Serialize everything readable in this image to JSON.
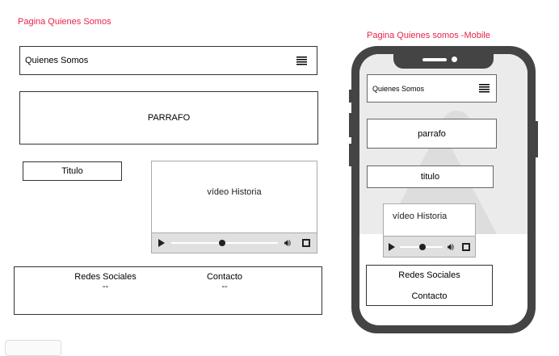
{
  "desktop": {
    "title": "Pagina Quienes Somos",
    "header": "Quienes Somos",
    "paragraph": "PARRAFO",
    "titulo": "Titulo",
    "video": "vídeo Historia",
    "footer": {
      "redes": "Redes Sociales",
      "redes_value": "--",
      "contacto": "Contacto",
      "contacto_value": "--"
    }
  },
  "mobile": {
    "title": "Pagina Quienes somos -Mobile",
    "header": "Quienes Somos",
    "paragraph": "parrafo",
    "titulo": "titulo",
    "video": "vídeo Historia",
    "footer": {
      "redes": "Redes Sociales",
      "contacto": "Contacto"
    }
  },
  "colors": {
    "annotation": "#e8224a",
    "phone_frame": "#444444"
  }
}
